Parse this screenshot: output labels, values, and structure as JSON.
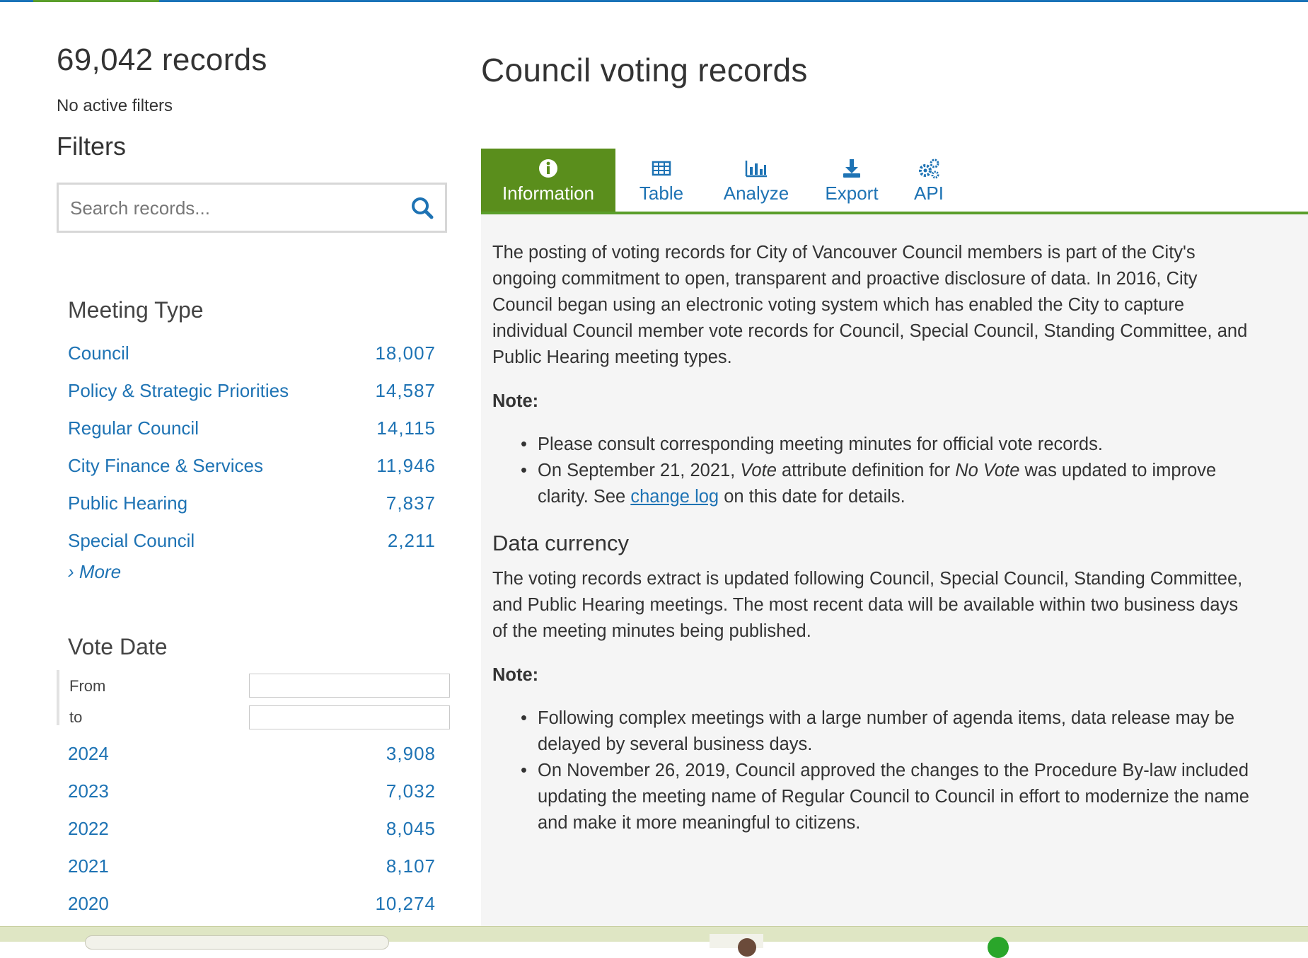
{
  "summary": {
    "record_count": "69,042 records",
    "active_filters": "No active filters",
    "filters_title": "Filters"
  },
  "search": {
    "placeholder": "Search records..."
  },
  "meeting_type": {
    "title": "Meeting Type",
    "items": [
      {
        "label": "Council",
        "count": "18,007"
      },
      {
        "label": "Policy & Strategic Priorities",
        "count": "14,587"
      },
      {
        "label": "Regular Council",
        "count": "14,115"
      },
      {
        "label": "City Finance & Services",
        "count": "11,946"
      },
      {
        "label": "Public Hearing",
        "count": "7,837"
      },
      {
        "label": "Special Council",
        "count": "2,211"
      }
    ],
    "more": "› More"
  },
  "vote_date": {
    "title": "Vote Date",
    "from_label": "From",
    "to_label": "to",
    "items": [
      {
        "label": "2024",
        "count": "3,908"
      },
      {
        "label": "2023",
        "count": "7,032"
      },
      {
        "label": "2022",
        "count": "8,045"
      },
      {
        "label": "2021",
        "count": "8,107"
      },
      {
        "label": "2020",
        "count": "10,274"
      }
    ]
  },
  "page_title": "Council voting records",
  "tabs": [
    {
      "label": "Information",
      "icon": "info-icon",
      "active": true
    },
    {
      "label": "Table",
      "icon": "table-icon",
      "active": false
    },
    {
      "label": "Analyze",
      "icon": "bar-chart-icon",
      "active": false
    },
    {
      "label": "Export",
      "icon": "download-icon",
      "active": false
    },
    {
      "label": "API",
      "icon": "gears-icon",
      "active": false
    }
  ],
  "content": {
    "intro": "The posting of voting records for City of Vancouver Council members is part of the City's ongoing commitment to open, transparent and proactive disclosure of data. In 2016, City Council began using an electronic voting system which has enabled the City to capture individual Council member vote records for Council, Special Council, Standing Committee, and Public Hearing meeting types.",
    "note_label": "Note:",
    "note1_item1": "Please consult corresponding meeting minutes for official vote records.",
    "note1_item2_a": "On September 21, 2021, ",
    "note1_item2_em1": "Vote",
    "note1_item2_b": " attribute definition for ",
    "note1_item2_em2": "No Vote",
    "note1_item2_c": " was updated to improve clarity. See ",
    "note1_item2_link": "change log",
    "note1_item2_d": " on this date for details.",
    "data_currency_title": "Data currency",
    "data_currency_text": "The voting records extract is updated following Council, Special Council, Standing Committee, and Public Hearing meetings. The most recent data will be available within two business days of the meeting minutes being published.",
    "note2_item1": "Following complex meetings with a large number of agenda items, data release may be delayed by several business days.",
    "note2_item2": "On November 26, 2019, Council approved the changes to the Procedure By-law included updating the meeting name of Regular Council to Council in effort to modernize the name and make it more meaningful to citizens."
  },
  "colors": {
    "link": "#1e73b4",
    "accent_green": "#5a9e2a",
    "active_tab": "#5a8e1c",
    "panel_bg": "#f5f5f5"
  }
}
